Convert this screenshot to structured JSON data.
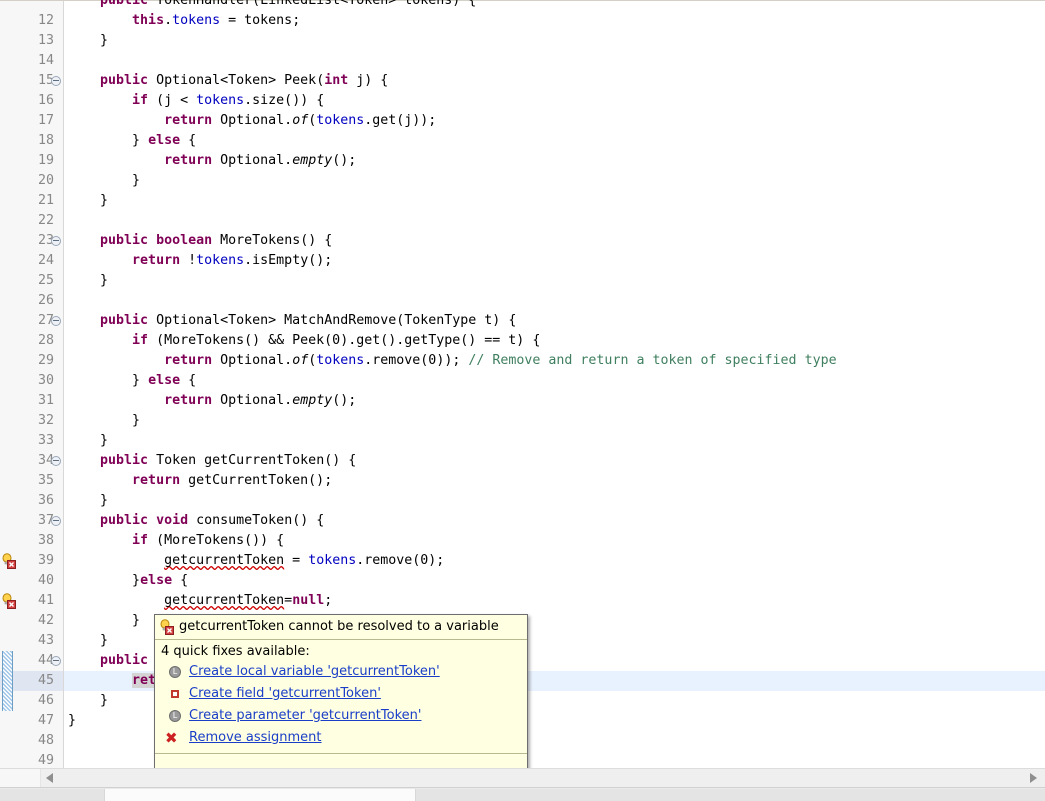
{
  "editor": {
    "first_visible_partial_line": "public TokenHandler(LinkedList<Token> tokens) {",
    "lines": [
      {
        "n": "12",
        "fold": false,
        "marker": "",
        "change": false,
        "current": false,
        "tokens": [
          {
            "t": "        ",
            "c": "plain"
          },
          {
            "t": "this",
            "c": "kw"
          },
          {
            "t": ".",
            "c": "plain"
          },
          {
            "t": "tokens",
            "c": "fld"
          },
          {
            "t": " = tokens;",
            "c": "plain"
          }
        ]
      },
      {
        "n": "13",
        "fold": false,
        "marker": "",
        "change": false,
        "current": false,
        "tokens": [
          {
            "t": "    }",
            "c": "plain"
          }
        ]
      },
      {
        "n": "14",
        "fold": false,
        "marker": "",
        "change": false,
        "current": false,
        "tokens": [
          {
            "t": "",
            "c": "plain"
          }
        ]
      },
      {
        "n": "15",
        "fold": true,
        "marker": "",
        "change": false,
        "current": false,
        "tokens": [
          {
            "t": "    ",
            "c": "plain"
          },
          {
            "t": "public",
            "c": "kw"
          },
          {
            "t": " Optional<Token> Peek(",
            "c": "plain"
          },
          {
            "t": "int",
            "c": "kw"
          },
          {
            "t": " j) {",
            "c": "plain"
          }
        ]
      },
      {
        "n": "16",
        "fold": false,
        "marker": "",
        "change": false,
        "current": false,
        "tokens": [
          {
            "t": "        ",
            "c": "plain"
          },
          {
            "t": "if",
            "c": "kw"
          },
          {
            "t": " (j < ",
            "c": "plain"
          },
          {
            "t": "tokens",
            "c": "fld"
          },
          {
            "t": ".size()) {",
            "c": "plain"
          }
        ]
      },
      {
        "n": "17",
        "fold": false,
        "marker": "",
        "change": false,
        "current": false,
        "tokens": [
          {
            "t": "            ",
            "c": "plain"
          },
          {
            "t": "return",
            "c": "kw"
          },
          {
            "t": " Optional.",
            "c": "plain"
          },
          {
            "t": "of",
            "c": "stat"
          },
          {
            "t": "(",
            "c": "plain"
          },
          {
            "t": "tokens",
            "c": "fld"
          },
          {
            "t": ".get(j));",
            "c": "plain"
          }
        ]
      },
      {
        "n": "18",
        "fold": false,
        "marker": "",
        "change": false,
        "current": false,
        "tokens": [
          {
            "t": "        } ",
            "c": "plain"
          },
          {
            "t": "else",
            "c": "kw"
          },
          {
            "t": " {",
            "c": "plain"
          }
        ]
      },
      {
        "n": "19",
        "fold": false,
        "marker": "",
        "change": false,
        "current": false,
        "tokens": [
          {
            "t": "            ",
            "c": "plain"
          },
          {
            "t": "return",
            "c": "kw"
          },
          {
            "t": " Optional.",
            "c": "plain"
          },
          {
            "t": "empty",
            "c": "stat"
          },
          {
            "t": "();",
            "c": "plain"
          }
        ]
      },
      {
        "n": "20",
        "fold": false,
        "marker": "",
        "change": false,
        "current": false,
        "tokens": [
          {
            "t": "        }",
            "c": "plain"
          }
        ]
      },
      {
        "n": "21",
        "fold": false,
        "marker": "",
        "change": false,
        "current": false,
        "tokens": [
          {
            "t": "    }",
            "c": "plain"
          }
        ]
      },
      {
        "n": "22",
        "fold": false,
        "marker": "",
        "change": false,
        "current": false,
        "tokens": [
          {
            "t": "",
            "c": "plain"
          }
        ]
      },
      {
        "n": "23",
        "fold": true,
        "marker": "",
        "change": false,
        "current": false,
        "tokens": [
          {
            "t": "    ",
            "c": "plain"
          },
          {
            "t": "public",
            "c": "kw"
          },
          {
            "t": " ",
            "c": "plain"
          },
          {
            "t": "boolean",
            "c": "kw"
          },
          {
            "t": " MoreTokens() {",
            "c": "plain"
          }
        ]
      },
      {
        "n": "24",
        "fold": false,
        "marker": "",
        "change": false,
        "current": false,
        "tokens": [
          {
            "t": "        ",
            "c": "plain"
          },
          {
            "t": "return",
            "c": "kw"
          },
          {
            "t": " !",
            "c": "plain"
          },
          {
            "t": "tokens",
            "c": "fld"
          },
          {
            "t": ".isEmpty();",
            "c": "plain"
          }
        ]
      },
      {
        "n": "25",
        "fold": false,
        "marker": "",
        "change": false,
        "current": false,
        "tokens": [
          {
            "t": "    }",
            "c": "plain"
          }
        ]
      },
      {
        "n": "26",
        "fold": false,
        "marker": "",
        "change": false,
        "current": false,
        "tokens": [
          {
            "t": "",
            "c": "plain"
          }
        ]
      },
      {
        "n": "27",
        "fold": true,
        "marker": "",
        "change": false,
        "current": false,
        "tokens": [
          {
            "t": "    ",
            "c": "plain"
          },
          {
            "t": "public",
            "c": "kw"
          },
          {
            "t": " Optional<Token> MatchAndRemove(TokenType t) {",
            "c": "plain"
          }
        ]
      },
      {
        "n": "28",
        "fold": false,
        "marker": "",
        "change": false,
        "current": false,
        "tokens": [
          {
            "t": "        ",
            "c": "plain"
          },
          {
            "t": "if",
            "c": "kw"
          },
          {
            "t": " (MoreTokens() && Peek(0).get().getType() == t) {",
            "c": "plain"
          }
        ]
      },
      {
        "n": "29",
        "fold": false,
        "marker": "",
        "change": false,
        "current": false,
        "tokens": [
          {
            "t": "            ",
            "c": "plain"
          },
          {
            "t": "return",
            "c": "kw"
          },
          {
            "t": " Optional.",
            "c": "plain"
          },
          {
            "t": "of",
            "c": "stat"
          },
          {
            "t": "(",
            "c": "plain"
          },
          {
            "t": "tokens",
            "c": "fld"
          },
          {
            "t": ".remove(0)); ",
            "c": "plain"
          },
          {
            "t": "// Remove and return a token of specified type",
            "c": "cmt"
          }
        ]
      },
      {
        "n": "30",
        "fold": false,
        "marker": "",
        "change": false,
        "current": false,
        "tokens": [
          {
            "t": "        } ",
            "c": "plain"
          },
          {
            "t": "else",
            "c": "kw"
          },
          {
            "t": " {",
            "c": "plain"
          }
        ]
      },
      {
        "n": "31",
        "fold": false,
        "marker": "",
        "change": false,
        "current": false,
        "tokens": [
          {
            "t": "            ",
            "c": "plain"
          },
          {
            "t": "return",
            "c": "kw"
          },
          {
            "t": " Optional.",
            "c": "plain"
          },
          {
            "t": "empty",
            "c": "stat"
          },
          {
            "t": "();",
            "c": "plain"
          }
        ]
      },
      {
        "n": "32",
        "fold": false,
        "marker": "",
        "change": false,
        "current": false,
        "tokens": [
          {
            "t": "        }",
            "c": "plain"
          }
        ]
      },
      {
        "n": "33",
        "fold": false,
        "marker": "",
        "change": false,
        "current": false,
        "tokens": [
          {
            "t": "    }",
            "c": "plain"
          }
        ]
      },
      {
        "n": "34",
        "fold": true,
        "marker": "",
        "change": false,
        "current": false,
        "tokens": [
          {
            "t": "    ",
            "c": "plain"
          },
          {
            "t": "public",
            "c": "kw"
          },
          {
            "t": " Token getCurrentToken() {",
            "c": "plain"
          }
        ]
      },
      {
        "n": "35",
        "fold": false,
        "marker": "",
        "change": false,
        "current": false,
        "tokens": [
          {
            "t": "        ",
            "c": "plain"
          },
          {
            "t": "return",
            "c": "kw"
          },
          {
            "t": " getCurrentToken();",
            "c": "plain"
          }
        ]
      },
      {
        "n": "36",
        "fold": false,
        "marker": "",
        "change": false,
        "current": false,
        "tokens": [
          {
            "t": "    }",
            "c": "plain"
          }
        ]
      },
      {
        "n": "37",
        "fold": true,
        "marker": "",
        "change": false,
        "current": false,
        "tokens": [
          {
            "t": "    ",
            "c": "plain"
          },
          {
            "t": "public",
            "c": "kw"
          },
          {
            "t": " ",
            "c": "plain"
          },
          {
            "t": "void",
            "c": "kw"
          },
          {
            "t": " consumeToken() {",
            "c": "plain"
          }
        ]
      },
      {
        "n": "38",
        "fold": false,
        "marker": "",
        "change": false,
        "current": false,
        "tokens": [
          {
            "t": "        ",
            "c": "plain"
          },
          {
            "t": "if",
            "c": "kw"
          },
          {
            "t": " (MoreTokens()) {",
            "c": "plain"
          }
        ]
      },
      {
        "n": "39",
        "fold": false,
        "marker": "error-quickfix",
        "change": false,
        "current": false,
        "tokens": [
          {
            "t": "            ",
            "c": "plain"
          },
          {
            "t": "getcurrentToken",
            "c": "plain err"
          },
          {
            "t": " = ",
            "c": "plain"
          },
          {
            "t": "tokens",
            "c": "fld"
          },
          {
            "t": ".remove(0);",
            "c": "plain"
          }
        ]
      },
      {
        "n": "40",
        "fold": false,
        "marker": "",
        "change": false,
        "current": false,
        "tokens": [
          {
            "t": "        }",
            "c": "plain"
          },
          {
            "t": "else",
            "c": "kw"
          },
          {
            "t": " {",
            "c": "plain"
          }
        ]
      },
      {
        "n": "41",
        "fold": false,
        "marker": "error-quickfix",
        "change": false,
        "current": false,
        "tokens": [
          {
            "t": "            ",
            "c": "plain"
          },
          {
            "t": "getcurrentToken",
            "c": "plain err"
          },
          {
            "t": "=",
            "c": "plain"
          },
          {
            "t": "null",
            "c": "kw"
          },
          {
            "t": ";",
            "c": "plain"
          }
        ]
      },
      {
        "n": "42",
        "fold": false,
        "marker": "",
        "change": false,
        "current": false,
        "tokens": [
          {
            "t": "        }",
            "c": "plain"
          }
        ]
      },
      {
        "n": "43",
        "fold": false,
        "marker": "",
        "change": false,
        "current": false,
        "tokens": [
          {
            "t": "    }",
            "c": "plain"
          }
        ]
      },
      {
        "n": "44",
        "fold": true,
        "marker": "",
        "change": true,
        "current": false,
        "tokens": [
          {
            "t": "    ",
            "c": "plain"
          },
          {
            "t": "public",
            "c": "kw"
          },
          {
            "t": " T",
            "c": "plain"
          }
        ]
      },
      {
        "n": "45",
        "fold": false,
        "marker": "",
        "change": true,
        "current": true,
        "tokens": [
          {
            "t": "        ",
            "c": "plain"
          },
          {
            "t": "retu",
            "c": "kw occ-hl"
          }
        ]
      },
      {
        "n": "46",
        "fold": false,
        "marker": "",
        "change": true,
        "current": false,
        "tokens": [
          {
            "t": "    }",
            "c": "plain"
          }
        ]
      },
      {
        "n": "47",
        "fold": false,
        "marker": "",
        "change": false,
        "current": false,
        "tokens": [
          {
            "t": "}",
            "c": "plain"
          }
        ]
      },
      {
        "n": "48",
        "fold": false,
        "marker": "",
        "change": false,
        "current": false,
        "tokens": [
          {
            "t": "",
            "c": "plain"
          }
        ]
      },
      {
        "n": "49",
        "fold": false,
        "marker": "",
        "change": false,
        "current": false,
        "tokens": [
          {
            "t": "",
            "c": "plain"
          }
        ]
      }
    ]
  },
  "quickfix": {
    "header_icon": "lightbulb-error-icon",
    "header_text": "getcurrentToken cannot be resolved to a variable",
    "available_text": "4 quick fixes available:",
    "items": [
      {
        "icon": "local-variable-icon",
        "icon_glyph": "L",
        "label": "Create local variable 'getcurrentToken'"
      },
      {
        "icon": "field-icon",
        "icon_glyph": "",
        "label": "Create field 'getcurrentToken'"
      },
      {
        "icon": "parameter-icon",
        "icon_glyph": "L",
        "label": "Create parameter 'getcurrentToken'"
      },
      {
        "icon": "remove-icon",
        "icon_glyph": "✖",
        "label": "Remove assignment"
      }
    ]
  },
  "scrollbar": {
    "left_arrow": "scroll-left-arrow",
    "right_arrow": "scroll-right-arrow"
  },
  "colors": {
    "keyword": "#7f0055",
    "field": "#0000c0",
    "comment": "#3f7f5f",
    "error_underline": "#cc0000",
    "popup_background": "#ffffe1",
    "link": "#1a3ec8",
    "current_line": "#e8f2fe"
  }
}
